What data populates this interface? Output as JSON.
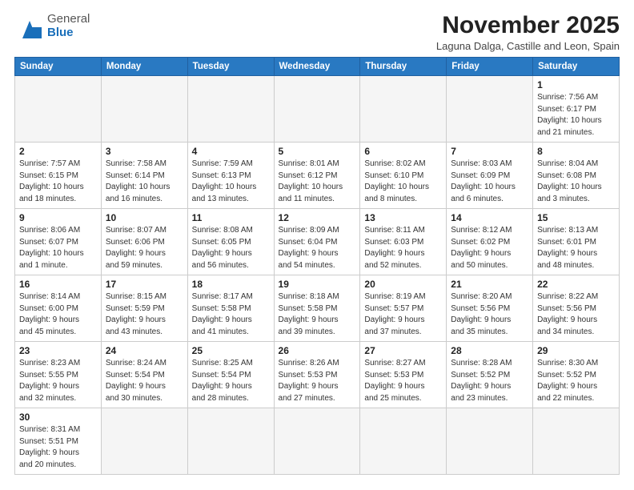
{
  "header": {
    "logo_line1": "General",
    "logo_line2": "Blue",
    "month_title": "November 2025",
    "subtitle": "Laguna Dalga, Castille and Leon, Spain"
  },
  "days_of_week": [
    "Sunday",
    "Monday",
    "Tuesday",
    "Wednesday",
    "Thursday",
    "Friday",
    "Saturday"
  ],
  "weeks": [
    [
      {
        "day": "",
        "info": ""
      },
      {
        "day": "",
        "info": ""
      },
      {
        "day": "",
        "info": ""
      },
      {
        "day": "",
        "info": ""
      },
      {
        "day": "",
        "info": ""
      },
      {
        "day": "",
        "info": ""
      },
      {
        "day": "1",
        "info": "Sunrise: 7:56 AM\nSunset: 6:17 PM\nDaylight: 10 hours\nand 21 minutes."
      }
    ],
    [
      {
        "day": "2",
        "info": "Sunrise: 7:57 AM\nSunset: 6:15 PM\nDaylight: 10 hours\nand 18 minutes."
      },
      {
        "day": "3",
        "info": "Sunrise: 7:58 AM\nSunset: 6:14 PM\nDaylight: 10 hours\nand 16 minutes."
      },
      {
        "day": "4",
        "info": "Sunrise: 7:59 AM\nSunset: 6:13 PM\nDaylight: 10 hours\nand 13 minutes."
      },
      {
        "day": "5",
        "info": "Sunrise: 8:01 AM\nSunset: 6:12 PM\nDaylight: 10 hours\nand 11 minutes."
      },
      {
        "day": "6",
        "info": "Sunrise: 8:02 AM\nSunset: 6:10 PM\nDaylight: 10 hours\nand 8 minutes."
      },
      {
        "day": "7",
        "info": "Sunrise: 8:03 AM\nSunset: 6:09 PM\nDaylight: 10 hours\nand 6 minutes."
      },
      {
        "day": "8",
        "info": "Sunrise: 8:04 AM\nSunset: 6:08 PM\nDaylight: 10 hours\nand 3 minutes."
      }
    ],
    [
      {
        "day": "9",
        "info": "Sunrise: 8:06 AM\nSunset: 6:07 PM\nDaylight: 10 hours\nand 1 minute."
      },
      {
        "day": "10",
        "info": "Sunrise: 8:07 AM\nSunset: 6:06 PM\nDaylight: 9 hours\nand 59 minutes."
      },
      {
        "day": "11",
        "info": "Sunrise: 8:08 AM\nSunset: 6:05 PM\nDaylight: 9 hours\nand 56 minutes."
      },
      {
        "day": "12",
        "info": "Sunrise: 8:09 AM\nSunset: 6:04 PM\nDaylight: 9 hours\nand 54 minutes."
      },
      {
        "day": "13",
        "info": "Sunrise: 8:11 AM\nSunset: 6:03 PM\nDaylight: 9 hours\nand 52 minutes."
      },
      {
        "day": "14",
        "info": "Sunrise: 8:12 AM\nSunset: 6:02 PM\nDaylight: 9 hours\nand 50 minutes."
      },
      {
        "day": "15",
        "info": "Sunrise: 8:13 AM\nSunset: 6:01 PM\nDaylight: 9 hours\nand 48 minutes."
      }
    ],
    [
      {
        "day": "16",
        "info": "Sunrise: 8:14 AM\nSunset: 6:00 PM\nDaylight: 9 hours\nand 45 minutes."
      },
      {
        "day": "17",
        "info": "Sunrise: 8:15 AM\nSunset: 5:59 PM\nDaylight: 9 hours\nand 43 minutes."
      },
      {
        "day": "18",
        "info": "Sunrise: 8:17 AM\nSunset: 5:58 PM\nDaylight: 9 hours\nand 41 minutes."
      },
      {
        "day": "19",
        "info": "Sunrise: 8:18 AM\nSunset: 5:58 PM\nDaylight: 9 hours\nand 39 minutes."
      },
      {
        "day": "20",
        "info": "Sunrise: 8:19 AM\nSunset: 5:57 PM\nDaylight: 9 hours\nand 37 minutes."
      },
      {
        "day": "21",
        "info": "Sunrise: 8:20 AM\nSunset: 5:56 PM\nDaylight: 9 hours\nand 35 minutes."
      },
      {
        "day": "22",
        "info": "Sunrise: 8:22 AM\nSunset: 5:56 PM\nDaylight: 9 hours\nand 34 minutes."
      }
    ],
    [
      {
        "day": "23",
        "info": "Sunrise: 8:23 AM\nSunset: 5:55 PM\nDaylight: 9 hours\nand 32 minutes."
      },
      {
        "day": "24",
        "info": "Sunrise: 8:24 AM\nSunset: 5:54 PM\nDaylight: 9 hours\nand 30 minutes."
      },
      {
        "day": "25",
        "info": "Sunrise: 8:25 AM\nSunset: 5:54 PM\nDaylight: 9 hours\nand 28 minutes."
      },
      {
        "day": "26",
        "info": "Sunrise: 8:26 AM\nSunset: 5:53 PM\nDaylight: 9 hours\nand 27 minutes."
      },
      {
        "day": "27",
        "info": "Sunrise: 8:27 AM\nSunset: 5:53 PM\nDaylight: 9 hours\nand 25 minutes."
      },
      {
        "day": "28",
        "info": "Sunrise: 8:28 AM\nSunset: 5:52 PM\nDaylight: 9 hours\nand 23 minutes."
      },
      {
        "day": "29",
        "info": "Sunrise: 8:30 AM\nSunset: 5:52 PM\nDaylight: 9 hours\nand 22 minutes."
      }
    ],
    [
      {
        "day": "30",
        "info": "Sunrise: 8:31 AM\nSunset: 5:51 PM\nDaylight: 9 hours\nand 20 minutes."
      },
      {
        "day": "",
        "info": ""
      },
      {
        "day": "",
        "info": ""
      },
      {
        "day": "",
        "info": ""
      },
      {
        "day": "",
        "info": ""
      },
      {
        "day": "",
        "info": ""
      },
      {
        "day": "",
        "info": ""
      }
    ]
  ]
}
